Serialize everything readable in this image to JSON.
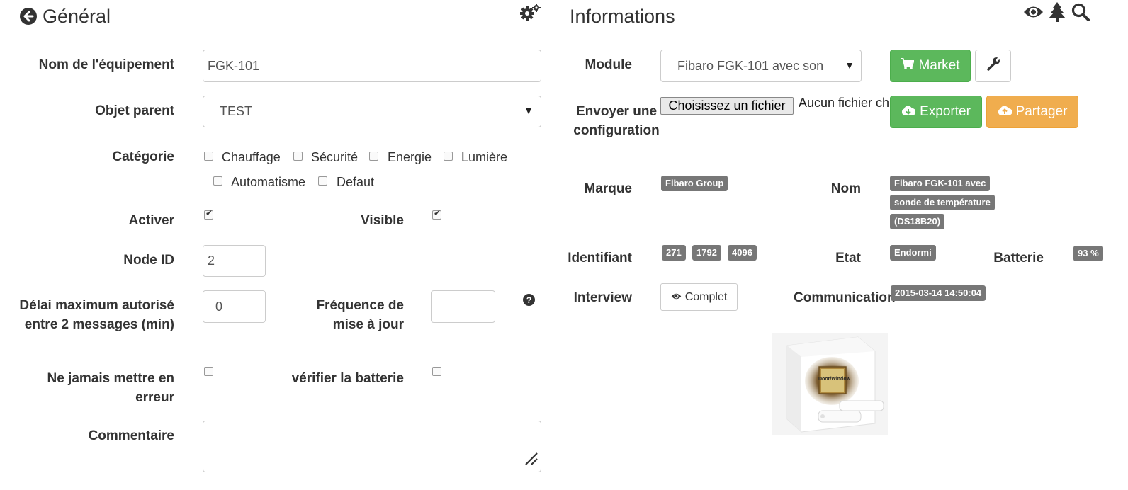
{
  "general": {
    "title": "Général",
    "name_label": "Nom de l'équipement",
    "name_value": "FGK-101",
    "parent_label": "Objet parent",
    "parent_value": "TEST",
    "category_label": "Catégorie",
    "categories": [
      "Chauffage",
      "Sécurité",
      "Energie",
      "Lumière",
      "Automatisme",
      "Defaut"
    ],
    "activate_label": "Activer",
    "visible_label": "Visible",
    "nodeid_label": "Node ID",
    "nodeid_value": "2",
    "delay_label": "Délai maximum autorisé entre 2 messages (min)",
    "delay_value": "0",
    "freq_label": "Fréquence de mise à jour",
    "freq_value": "",
    "never_error_label": "Ne jamais mettre en erreur",
    "battery_check_label": "vérifier la batterie",
    "comment_label": "Commentaire",
    "comment_value": ""
  },
  "info": {
    "title": "Informations",
    "module_label": "Module",
    "module_value": "Fibaro FGK-101 avec son",
    "market_label": "Market",
    "upload_label": "Envoyer une configuration",
    "file_button": "Choisissez un fichier",
    "file_none": "Aucun fichier ch",
    "export_label": "Exporter",
    "share_label": "Partager",
    "brand_label": "Marque",
    "brand_value": "Fibaro Group",
    "name_label": "Nom",
    "name_lines": [
      "Fibaro FGK-101 avec",
      "sonde de température",
      "(DS18B20)"
    ],
    "id_label": "Identifiant",
    "ids": [
      "271",
      "1792",
      "4096"
    ],
    "state_label": "Etat",
    "state_value": "Endormi",
    "battery_label": "Batterie",
    "battery_value": "93 %",
    "interview_label": "Interview",
    "interview_value": "Complet",
    "comm_label": "Communication",
    "comm_value": "2015-03-14 14:50:04",
    "product_box_text": "Door/Window"
  },
  "colors": {
    "green": "#5cb85c",
    "orange": "#f0ad4e",
    "badge": "#777777"
  }
}
